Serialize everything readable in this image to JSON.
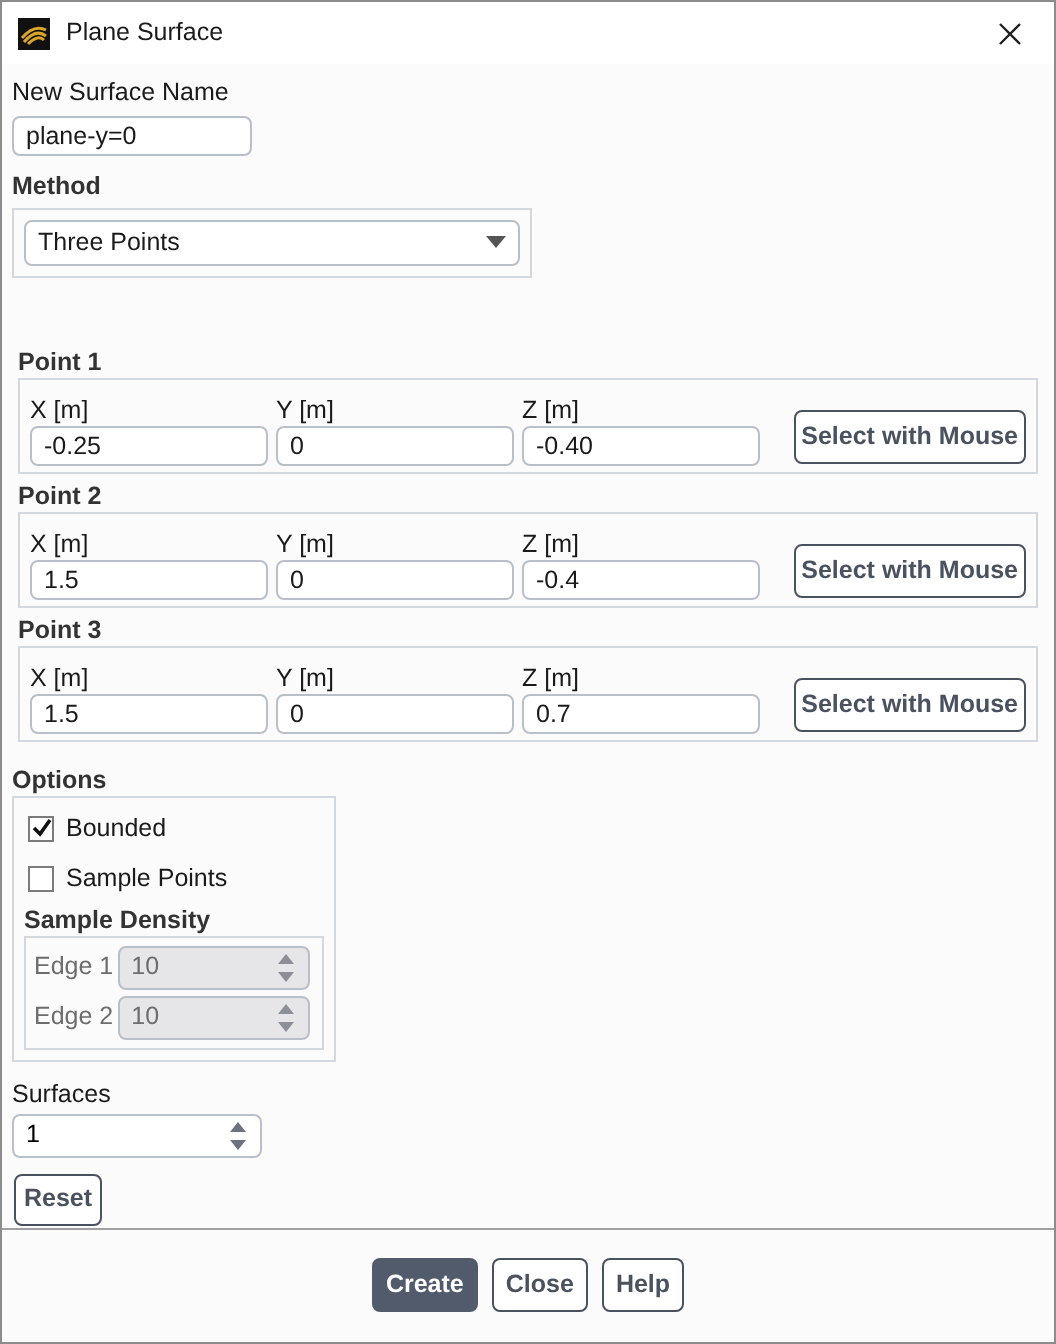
{
  "window": {
    "title": "Plane Surface"
  },
  "name_field": {
    "label": "New Surface Name",
    "value": "plane-y=0"
  },
  "method": {
    "label": "Method",
    "value": "Three Points"
  },
  "points": [
    {
      "title": "Point 1",
      "fields": [
        {
          "label": "X [m]",
          "value": "-0.25"
        },
        {
          "label": "Y [m]",
          "value": "0"
        },
        {
          "label": "Z [m]",
          "value": "-0.40"
        }
      ],
      "button": "Select with Mouse"
    },
    {
      "title": "Point 2",
      "fields": [
        {
          "label": "X [m]",
          "value": "1.5"
        },
        {
          "label": "Y [m]",
          "value": "0"
        },
        {
          "label": "Z [m]",
          "value": "-0.4"
        }
      ],
      "button": "Select with Mouse"
    },
    {
      "title": "Point 3",
      "fields": [
        {
          "label": "X [m]",
          "value": "1.5"
        },
        {
          "label": "Y [m]",
          "value": "0"
        },
        {
          "label": "Z [m]",
          "value": "0.7"
        }
      ],
      "button": "Select with Mouse"
    }
  ],
  "options": {
    "title": "Options",
    "checkboxes": [
      {
        "label": "Bounded",
        "checked": true
      },
      {
        "label": "Sample Points",
        "checked": false
      }
    ],
    "sample_density": {
      "title": "Sample Density",
      "disabled": true,
      "edges": [
        {
          "label": "Edge 1",
          "value": "10"
        },
        {
          "label": "Edge 2",
          "value": "10"
        }
      ]
    }
  },
  "surfaces": {
    "label": "Surfaces",
    "value": "1"
  },
  "reset_button": "Reset",
  "footer_buttons": [
    {
      "label": "Create",
      "kind": "primary"
    },
    {
      "label": "Close",
      "kind": "default"
    },
    {
      "label": "Help",
      "kind": "default"
    }
  ]
}
